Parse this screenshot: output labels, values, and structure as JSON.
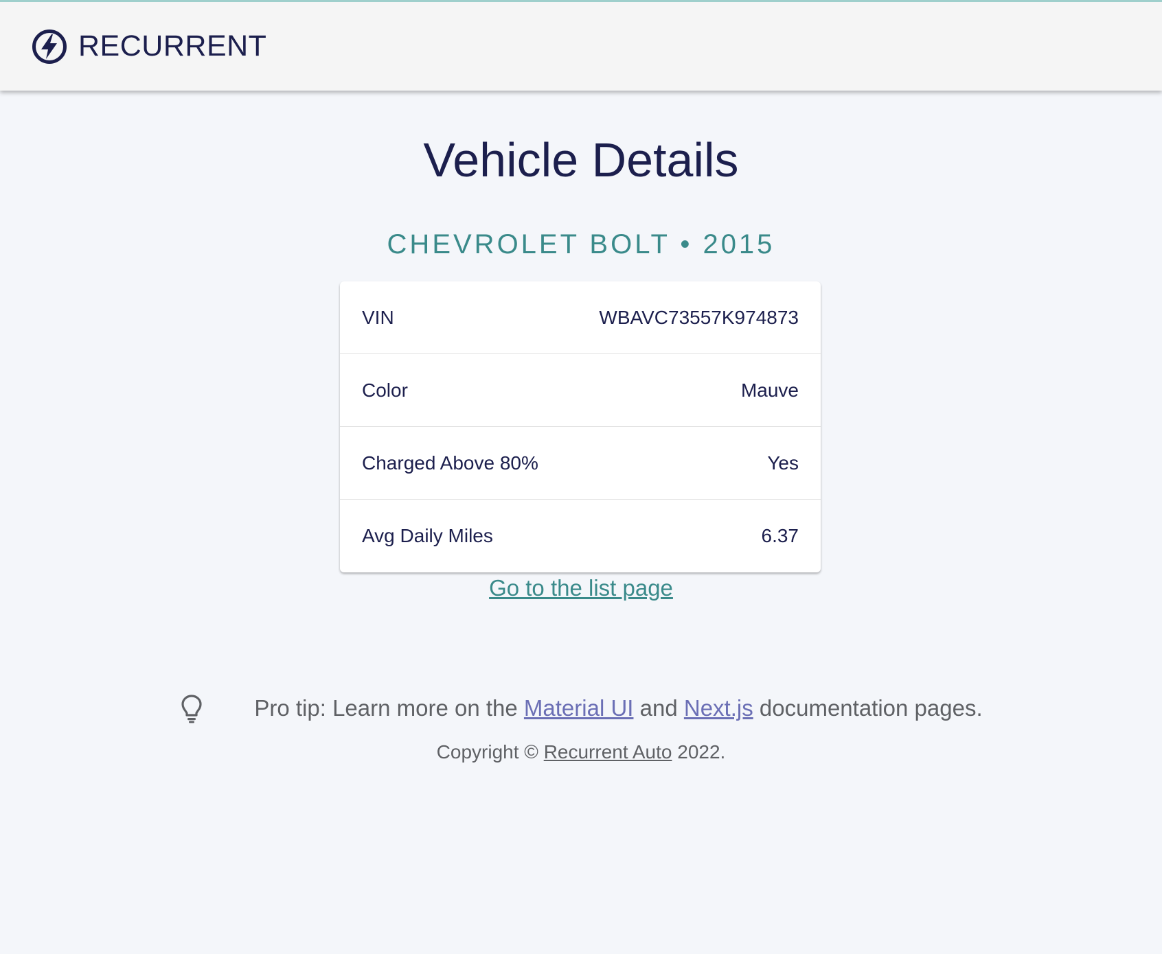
{
  "header": {
    "brand": "RECURRENT",
    "logo_icon": "lightning-bolt-circle-icon"
  },
  "main": {
    "title": "Vehicle Details",
    "vehicle_heading": "CHEVROLET BOLT • 2015",
    "details": [
      {
        "label": "VIN",
        "value": "WBAVC73557K974873"
      },
      {
        "label": "Color",
        "value": "Mauve"
      },
      {
        "label": "Charged Above 80%",
        "value": "Yes"
      },
      {
        "label": "Avg Daily Miles",
        "value": "6.37"
      }
    ],
    "list_link": "Go to the list page"
  },
  "protip": {
    "icon": "lightbulb-icon",
    "prefix": "Pro tip: Learn more on the ",
    "link1": "Material UI",
    "middle": " and ",
    "link2": "Next.js",
    "suffix": " documentation pages."
  },
  "footer": {
    "prefix": "Copyright © ",
    "link": "Recurrent Auto",
    "suffix": " 2022."
  },
  "colors": {
    "navy": "#1c1f4d",
    "teal": "#3a8a8a",
    "link_purple": "#6b6fb5",
    "background": "#f4f6fa"
  }
}
